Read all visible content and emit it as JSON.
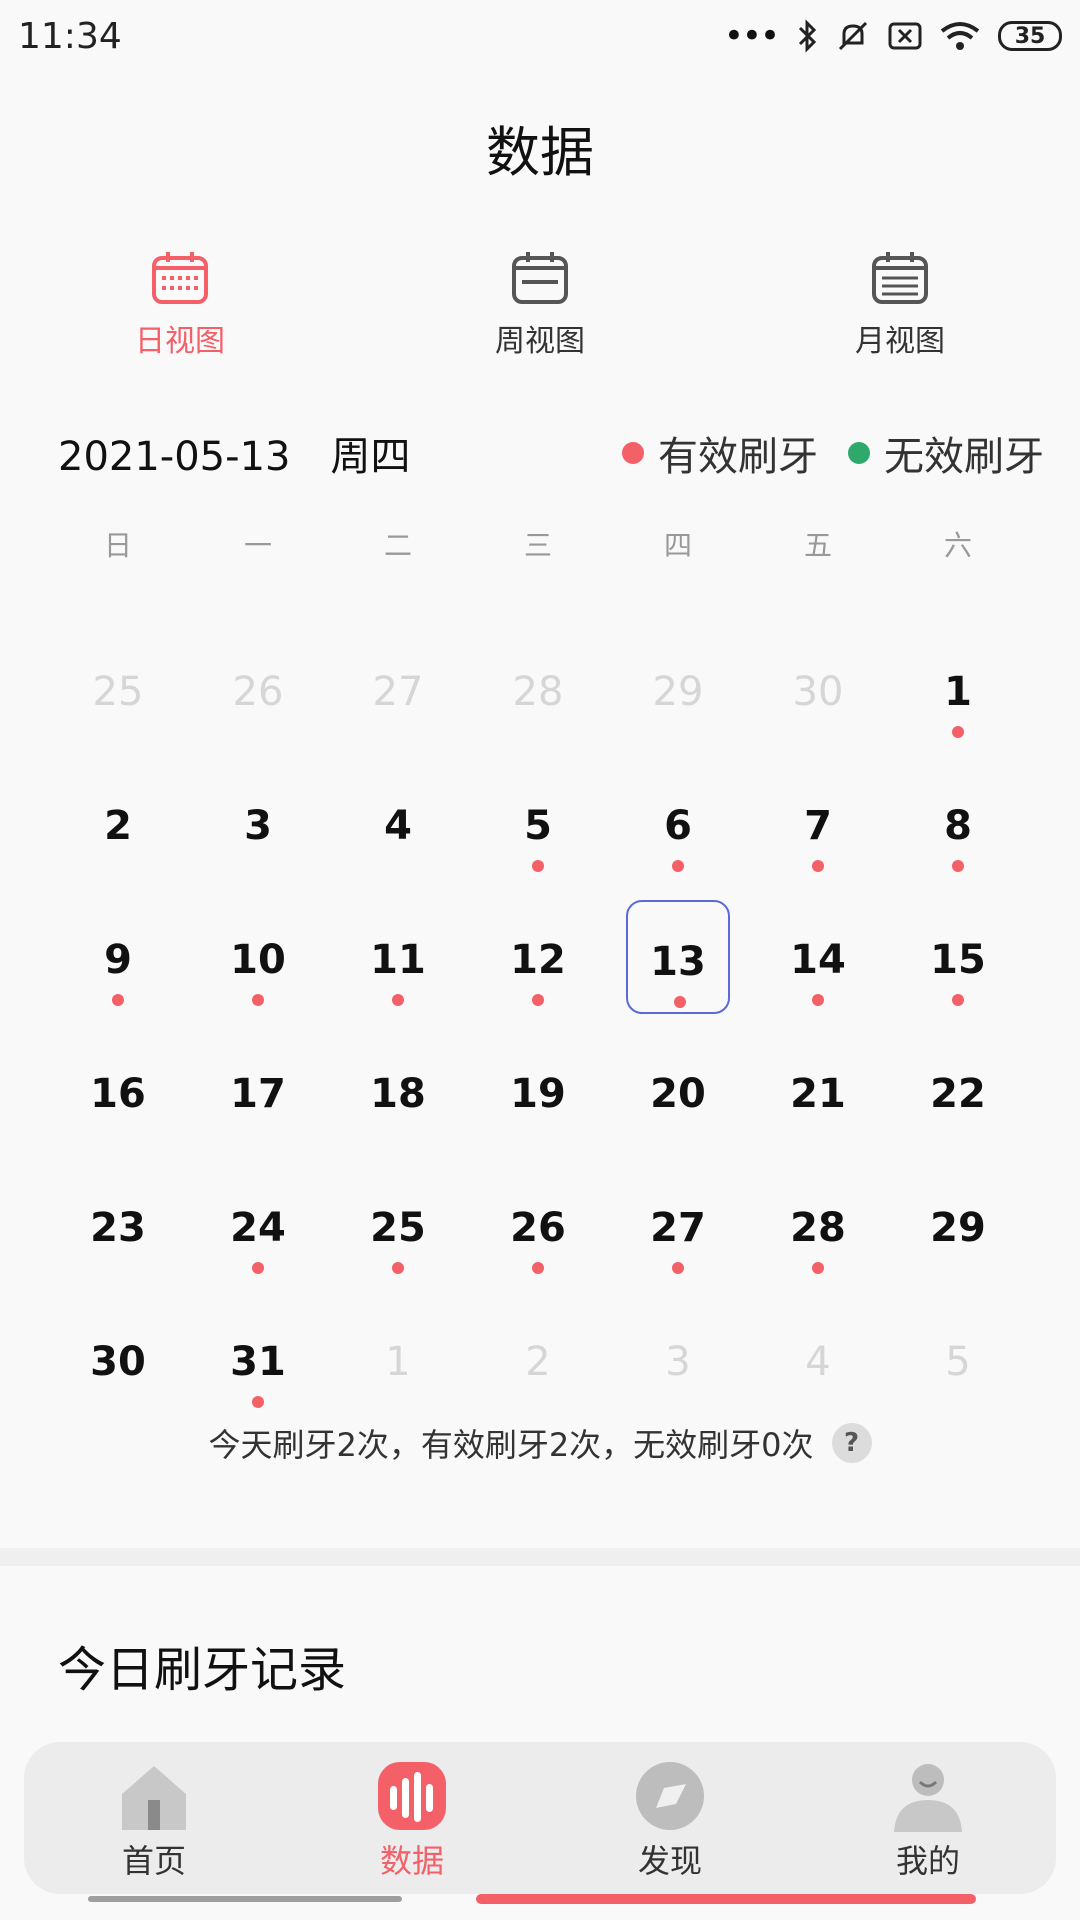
{
  "status_bar": {
    "time": "11:34",
    "battery": "35"
  },
  "header": {
    "title": "数据"
  },
  "view_tabs": [
    {
      "label": "日视图",
      "active": true
    },
    {
      "label": "周视图",
      "active": false
    },
    {
      "label": "月视图",
      "active": false
    }
  ],
  "date_header": {
    "date": "2021-05-13",
    "weekday": "周四"
  },
  "legend": {
    "valid": {
      "label": "有效刷牙",
      "color": "#f36068"
    },
    "invalid": {
      "label": "无效刷牙",
      "color": "#2fa86c"
    }
  },
  "weekdays": [
    "日",
    "一",
    "二",
    "三",
    "四",
    "五",
    "六"
  ],
  "calendar": {
    "rows": [
      [
        {
          "d": "25",
          "o": true
        },
        {
          "d": "26",
          "o": true
        },
        {
          "d": "27",
          "o": true
        },
        {
          "d": "28",
          "o": true
        },
        {
          "d": "29",
          "o": true
        },
        {
          "d": "30",
          "o": true
        },
        {
          "d": "1",
          "dot": true
        }
      ],
      [
        {
          "d": "2"
        },
        {
          "d": "3"
        },
        {
          "d": "4"
        },
        {
          "d": "5",
          "dot": true
        },
        {
          "d": "6",
          "dot": true
        },
        {
          "d": "7",
          "dot": true
        },
        {
          "d": "8",
          "dot": true
        }
      ],
      [
        {
          "d": "9",
          "dot": true
        },
        {
          "d": "10",
          "dot": true
        },
        {
          "d": "11",
          "dot": true
        },
        {
          "d": "12",
          "dot": true
        },
        {
          "d": "13",
          "dot": true,
          "sel": true
        },
        {
          "d": "14",
          "dot": true
        },
        {
          "d": "15",
          "dot": true
        }
      ],
      [
        {
          "d": "16"
        },
        {
          "d": "17"
        },
        {
          "d": "18"
        },
        {
          "d": "19"
        },
        {
          "d": "20"
        },
        {
          "d": "21"
        },
        {
          "d": "22"
        }
      ],
      [
        {
          "d": "23"
        },
        {
          "d": "24",
          "dot": true
        },
        {
          "d": "25",
          "dot": true
        },
        {
          "d": "26",
          "dot": true
        },
        {
          "d": "27",
          "dot": true
        },
        {
          "d": "28",
          "dot": true
        },
        {
          "d": "29"
        }
      ],
      [
        {
          "d": "30"
        },
        {
          "d": "31",
          "dot": true
        },
        {
          "d": "1",
          "o": true
        },
        {
          "d": "2",
          "o": true
        },
        {
          "d": "3",
          "o": true
        },
        {
          "d": "4",
          "o": true
        },
        {
          "d": "5",
          "o": true
        }
      ]
    ]
  },
  "summary": {
    "text": "今天刷牙2次，有效刷牙2次，无效刷牙0次",
    "help": "?"
  },
  "section": {
    "title": "今日刷牙记录"
  },
  "bottom_nav": [
    {
      "label": "首页",
      "icon": "home-icon",
      "active": false
    },
    {
      "label": "数据",
      "icon": "data-icon",
      "active": true
    },
    {
      "label": "发现",
      "icon": "compass-icon",
      "active": false
    },
    {
      "label": "我的",
      "icon": "user-icon",
      "active": false
    }
  ]
}
